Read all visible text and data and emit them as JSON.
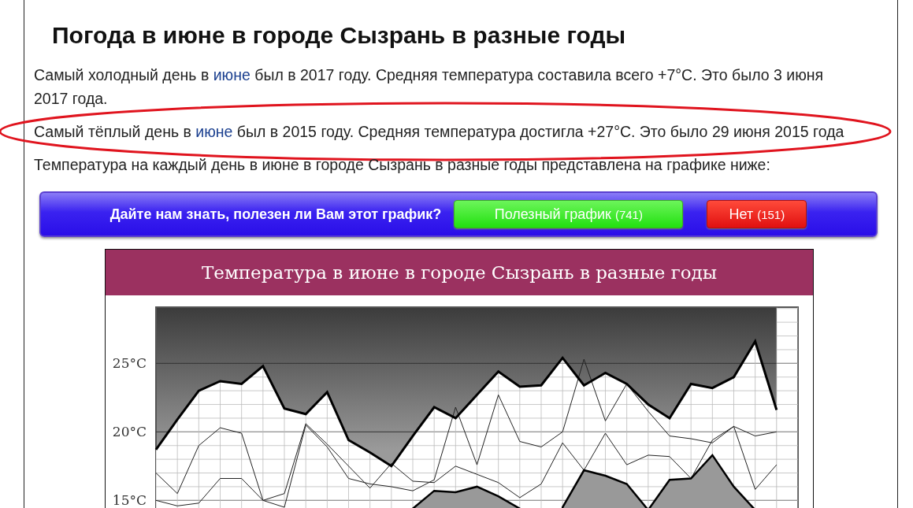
{
  "heading": "Погода в июне в городе Сызрань в разные годы",
  "paragraphs": [
    {
      "before": "Самый холодный день в ",
      "link": "июне",
      "after": " был в 2017 году. Средняя температура составила всего +7°C. Это было 3 июня 2017 года.",
      "circled": false
    },
    {
      "before": "Самый тёплый день в ",
      "link": "июне",
      "after": " был в 2015 году. Средняя температура достигла +27°C. Это было 29 июня 2015 года",
      "circled": true
    },
    {
      "before": "Температура на каждый день в июне в городе Сызрань в разные годы представлена на графике ниже:",
      "circled": false
    }
  ],
  "feedback": {
    "question": "Дайте нам знать, полезен ли Вам этот график?",
    "buttons": [
      {
        "kind": "yes",
        "label": "Полезный график",
        "count": "(741)"
      },
      {
        "kind": "no",
        "label": "Нет",
        "count": "(151)"
      }
    ]
  },
  "chart": {
    "title": "Температура в июне в городе Сызрань в разные годы",
    "chart_data": {
      "type": "line",
      "ylim": [
        14.2,
        29.1
      ],
      "grid": true,
      "yticks": [
        {
          "value": 15,
          "label": "15°C"
        },
        {
          "value": 20,
          "label": "20°C"
        },
        {
          "value": 25,
          "label": "25°C"
        }
      ],
      "categories": [
        null,
        null,
        null,
        null,
        null,
        null,
        null,
        null,
        null,
        null,
        null,
        null,
        null,
        null,
        null,
        null,
        null,
        null,
        null,
        null,
        null,
        null,
        null,
        null,
        null,
        null,
        null,
        null,
        null,
        null
      ],
      "series": [
        {
          "type": "area",
          "values": [
            18.7,
            20.9,
            23.0,
            23.7,
            23.5,
            24.8,
            21.7,
            21.3,
            22.9,
            19.4,
            18.5,
            17.5,
            19.7,
            21.8,
            21.0,
            22.7,
            24.4,
            23.3,
            23.4,
            25.4,
            23.4,
            24.3,
            23.5,
            22.0,
            21.0,
            23.5,
            23.2,
            24.0,
            26.6,
            21.6
          ]
        },
        {
          "type": "line",
          "values": [
            17.0,
            15.5,
            19.0,
            20.3,
            19.9,
            15.0,
            14.5,
            20.5,
            18.9,
            16.6,
            16.2,
            16.0,
            15.7,
            16.5,
            21.8,
            17.6,
            22.7,
            19.3,
            18.9,
            20.0,
            25.3,
            20.8,
            23.5,
            21.5,
            19.7,
            19.5,
            19.2,
            20.4,
            19.7,
            20.0
          ]
        },
        {
          "type": "line",
          "values": [
            15.0,
            14.6,
            14.8,
            16.6,
            16.6,
            15.0,
            15.5,
            20.6,
            19.1,
            17.5,
            15.9,
            17.7,
            16.4,
            16.3,
            17.5,
            16.9,
            16.3,
            15.2,
            16.2,
            19.2,
            17.2,
            19.9,
            17.6,
            18.3,
            18.2,
            16.6,
            19.4,
            20.4,
            15.8,
            17.6
          ]
        },
        {
          "type": "area",
          "values": [
            null,
            null,
            null,
            null,
            null,
            null,
            null,
            null,
            null,
            null,
            null,
            null,
            14.4,
            15.7,
            15.6,
            16.0,
            15.3,
            14.4,
            null,
            14.5,
            17.2,
            16.8,
            16.2,
            14.3,
            16.5,
            16.6,
            18.3,
            16.0,
            14.3,
            null
          ]
        }
      ]
    }
  }
}
